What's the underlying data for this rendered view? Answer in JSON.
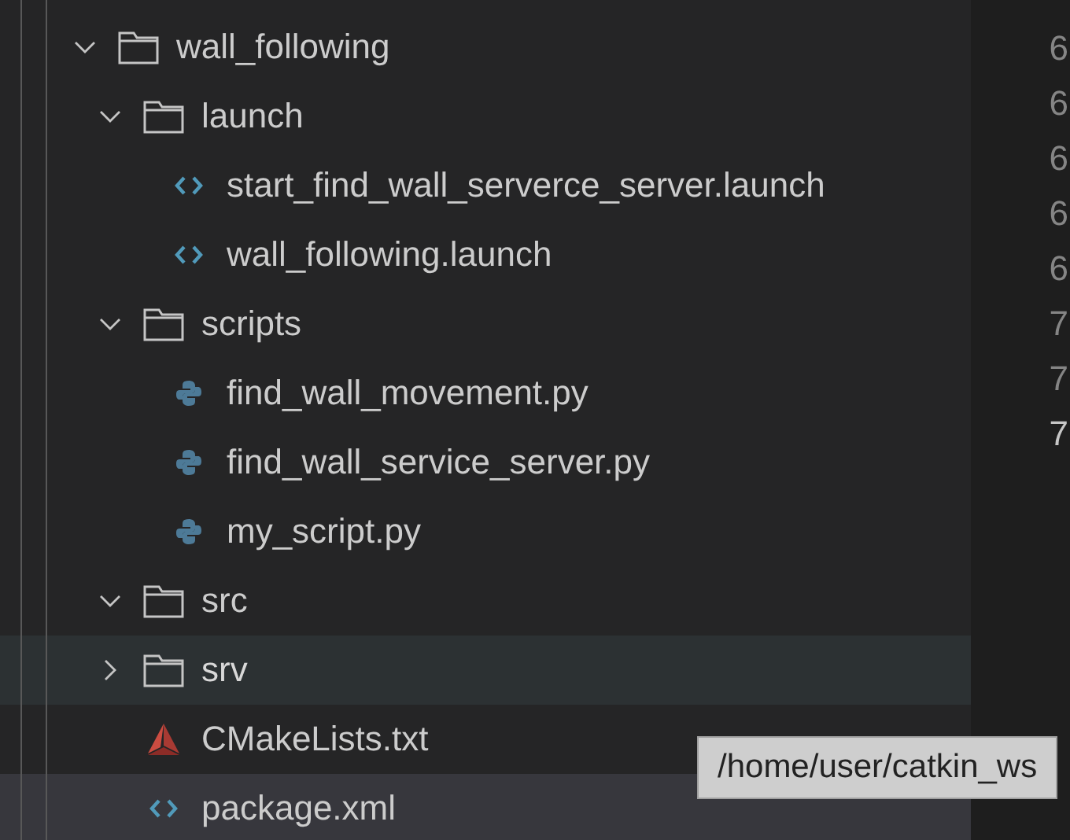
{
  "tree": [
    {
      "name": "wall_following",
      "kind": "folder",
      "expanded": true,
      "selected": false,
      "hovered": false,
      "children": [
        {
          "name": "launch",
          "kind": "folder",
          "expanded": true,
          "selected": false,
          "hovered": false,
          "children": [
            {
              "name": "start_find_wall_serverce_server.launch",
              "kind": "xml",
              "selected": false,
              "hovered": false
            },
            {
              "name": "wall_following.launch",
              "kind": "xml",
              "selected": false,
              "hovered": false
            }
          ]
        },
        {
          "name": "scripts",
          "kind": "folder",
          "expanded": true,
          "selected": false,
          "hovered": false,
          "children": [
            {
              "name": "find_wall_movement.py",
              "kind": "python",
              "selected": false,
              "hovered": false
            },
            {
              "name": "find_wall_service_server.py",
              "kind": "python",
              "selected": false,
              "hovered": false
            },
            {
              "name": "my_script.py",
              "kind": "python",
              "selected": false,
              "hovered": false
            }
          ]
        },
        {
          "name": "src",
          "kind": "folder",
          "expanded": true,
          "selected": false,
          "hovered": false
        },
        {
          "name": "srv",
          "kind": "folder",
          "expanded": false,
          "selected": false,
          "hovered": true
        },
        {
          "name": "CMakeLists.txt",
          "kind": "cmake",
          "selected": false,
          "hovered": false
        },
        {
          "name": "package.xml",
          "kind": "xml",
          "selected": true,
          "hovered": false
        }
      ]
    }
  ],
  "gutter": [
    {
      "number": "6",
      "current": false
    },
    {
      "number": "6",
      "current": false
    },
    {
      "number": "6",
      "current": false
    },
    {
      "number": "6",
      "current": false
    },
    {
      "number": "6",
      "current": false
    },
    {
      "number": "7",
      "current": false
    },
    {
      "number": "7",
      "current": false
    },
    {
      "number": "7",
      "current": true
    }
  ],
  "tooltip": "/home/user/catkin_ws"
}
